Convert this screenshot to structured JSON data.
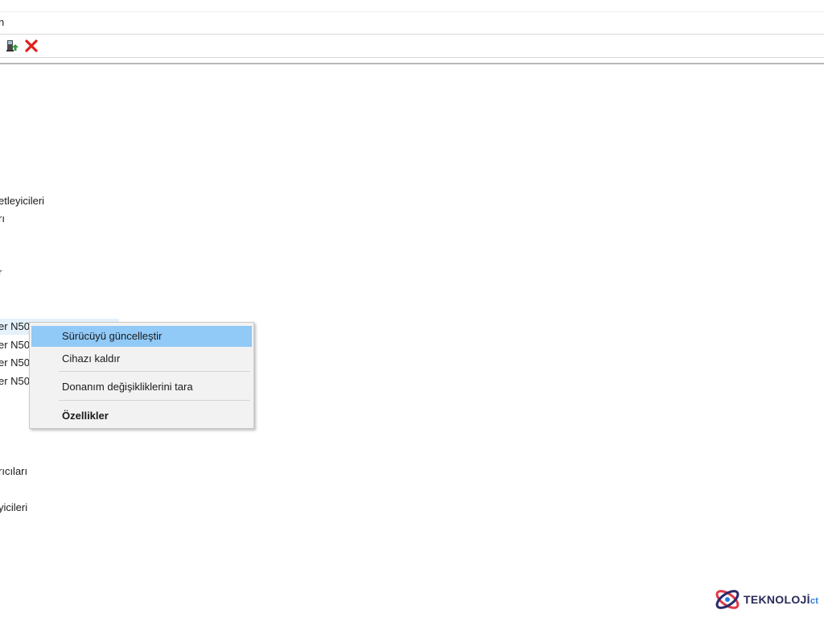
{
  "menubar": {
    "fragment": "n"
  },
  "toolbar": {
    "icons": [
      "update-driver-icon",
      "uninstall-icon"
    ],
    "colors": {
      "uninstall": "#e0201c",
      "update": "#2e9a3a"
    }
  },
  "tree": {
    "items": [
      {
        "label": "etleyicileri"
      },
      {
        "label": "rı"
      },
      {
        "label": "r"
      },
      {
        "label": "er N50"
      },
      {
        "label": "er N50"
      },
      {
        "label": "er N50"
      },
      {
        "label": "er N50"
      },
      {
        "label": "rıcıları"
      },
      {
        "label": "yicileri"
      }
    ]
  },
  "context_menu": {
    "items": [
      {
        "label": "Sürücüyü güncelleştir"
      },
      {
        "label": "Cihazı kaldır"
      },
      {
        "label": "Donanım değişikliklerini tara"
      },
      {
        "label": "Özellikler"
      }
    ],
    "highlight_color": "#91c9f7"
  },
  "watermark": {
    "text": "TEKNOLOJİ",
    "suffix": "ct"
  }
}
